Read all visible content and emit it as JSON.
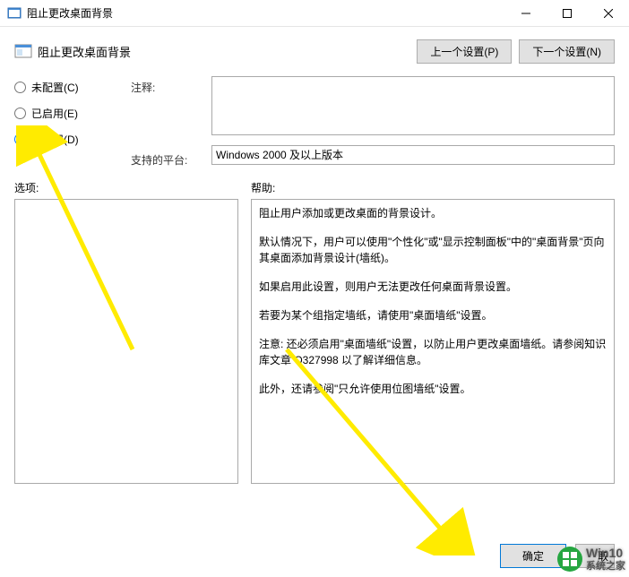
{
  "window": {
    "title": "阻止更改桌面背景"
  },
  "header": {
    "title": "阻止更改桌面背景",
    "prev": "上一个设置(P)",
    "next": "下一个设置(N)"
  },
  "radio": {
    "not_configured": "未配置(C)",
    "enabled": "已启用(E)",
    "disabled": "已禁用(D)",
    "selected": "disabled"
  },
  "labels": {
    "comment": "注释:",
    "platform": "支持的平台:",
    "options": "选项:",
    "help": "帮助:"
  },
  "fields": {
    "comment_value": "",
    "platform_value": "Windows 2000 及以上版本"
  },
  "help_paragraphs": [
    "阻止用户添加或更改桌面的背景设计。",
    "默认情况下，用户可以使用\"个性化\"或\"显示控制面板\"中的\"桌面背景\"页向其桌面添加背景设计(墙纸)。",
    "如果启用此设置，则用户无法更改任何桌面背景设置。",
    "若要为某个组指定墙纸，请使用\"桌面墙纸\"设置。",
    "注意: 还必须启用\"桌面墙纸\"设置，以防止用户更改桌面墙纸。请参阅知识库文章 Q327998 以了解详细信息。",
    "此外，还请参阅\"只允许使用位图墙纸\"设置。"
  ],
  "footer": {
    "ok": "确定",
    "cancel_partial": "取"
  },
  "watermark": {
    "line1": "Win10",
    "line2": "系统之家"
  }
}
